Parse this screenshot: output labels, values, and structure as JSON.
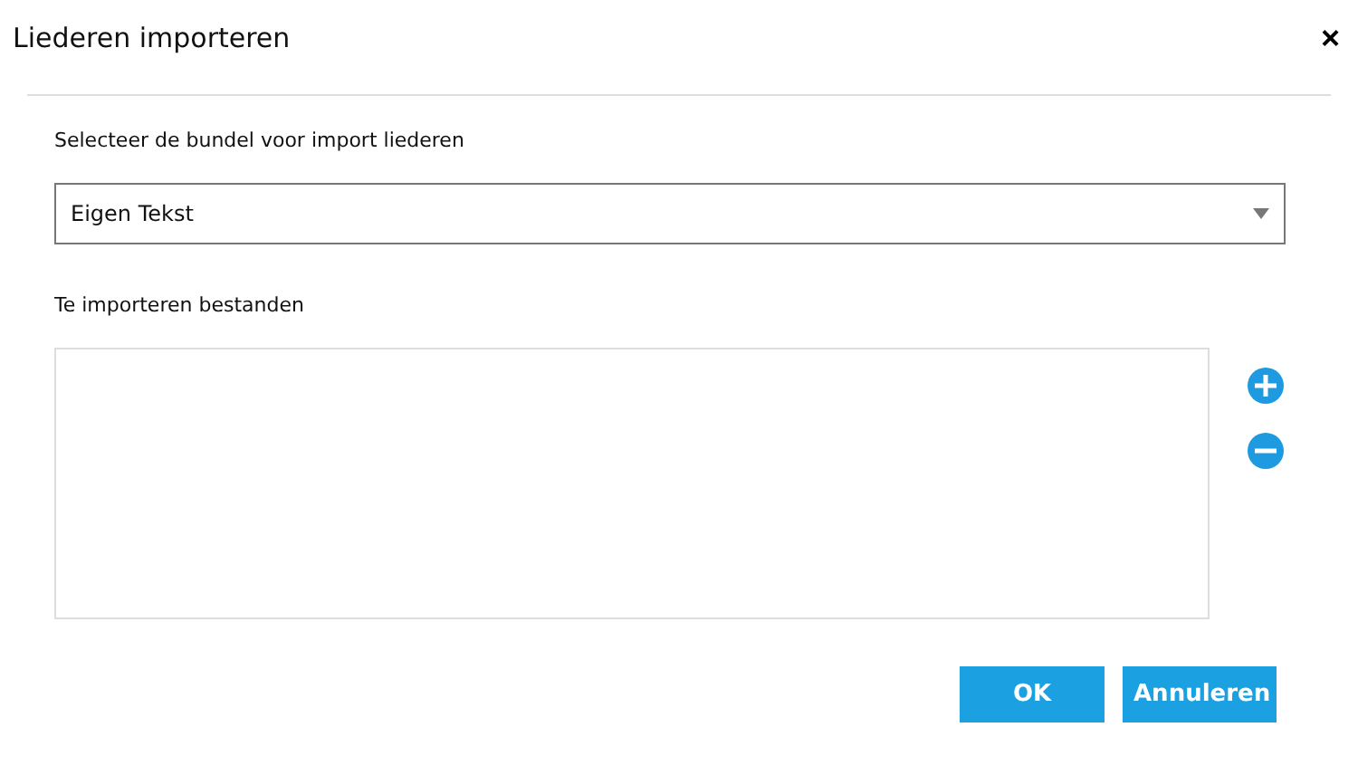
{
  "window": {
    "title": "Liederen importeren",
    "close": "×"
  },
  "bundle": {
    "label": "Selecteer de bundel voor import liederen",
    "value": "Eigen Tekst"
  },
  "files": {
    "label": "Te importeren bestanden"
  },
  "buttons": [
    {
      "label": "OK"
    },
    {
      "label": "Annuleren"
    }
  ]
}
